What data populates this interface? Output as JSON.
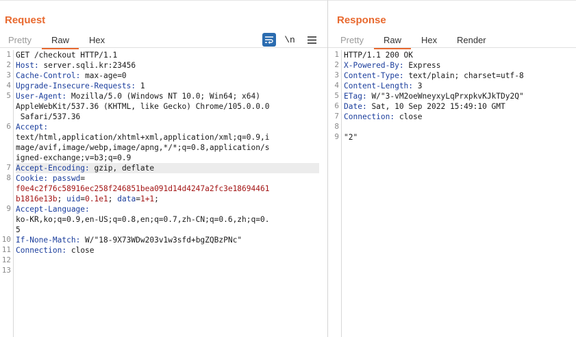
{
  "request": {
    "title": "Request",
    "tabs": [
      "Pretty",
      "Raw",
      "Hex"
    ],
    "active_tab": "Raw",
    "tools": {
      "wrap_icon": "wrap-lines-icon",
      "newline_label": "\\n",
      "menu_icon": "hamburger-menu-icon"
    },
    "line_numbers": [
      "1",
      "2",
      "3",
      "4",
      "5",
      "6",
      "7",
      "8",
      "9",
      "10",
      "11",
      "12",
      "13"
    ],
    "lines": [
      {
        "key": "",
        "val": "GET /checkout HTTP/1.1"
      },
      {
        "key": "Host",
        "val": " server.sqli.kr:23456"
      },
      {
        "key": "Cache-Control",
        "val": " max-age=0"
      },
      {
        "key": "Upgrade-Insecure-Requests",
        "val": " 1"
      },
      {
        "key": "User-Agent",
        "val": " Mozilla/5.0 (Windows NT 10.0; Win64; x64)"
      },
      {
        "key": "",
        "val": "AppleWebKit/537.36 (KHTML, like Gecko) Chrome/105.0.0.0"
      },
      {
        "key": "",
        "val": " Safari/537.36"
      },
      {
        "key": "Accept",
        "val": ""
      },
      {
        "key": "",
        "val": "text/html,application/xhtml+xml,application/xml;q=0.9,i"
      },
      {
        "key": "",
        "val": "mage/avif,image/webp,image/apng,*/*;q=0.8,application/s"
      },
      {
        "key": "",
        "val": "igned-exchange;v=b3;q=0.9"
      },
      {
        "key": "Accept-Encoding",
        "val": " gzip, deflate"
      },
      {
        "key": "Cookie",
        "val": " "
      },
      {
        "key": "",
        "val": "f0e4c2f76c58916ec258f246851bea091d14d4247a2fc3e18694461"
      },
      {
        "key": "",
        "val": "b1816e13b"
      },
      {
        "key": "Accept-Language",
        "val": ""
      },
      {
        "key": "",
        "val": "ko-KR,ko;q=0.9,en-US;q=0.8,en;q=0.7,zh-CN;q=0.6,zh;q=0."
      },
      {
        "key": "",
        "val": "5"
      },
      {
        "key": "If-None-Match",
        "val": " W/\"18-9X73WDw203v1w3sfd+bgZQBzPNc\""
      },
      {
        "key": "Connection",
        "val": " close"
      }
    ],
    "cookie": {
      "passwd_key": "passwd",
      "uid_key": "uid",
      "uid_val": "0.1e1",
      "data_key": "data",
      "data_val": "1+1"
    }
  },
  "response": {
    "title": "Response",
    "tabs": [
      "Pretty",
      "Raw",
      "Hex",
      "Render"
    ],
    "active_tab": "Raw",
    "line_numbers": [
      "1",
      "2",
      "3",
      "4",
      "5",
      "6",
      "7",
      "8",
      "9"
    ],
    "lines": [
      {
        "key": "",
        "val": "HTTP/1.1 200 OK"
      },
      {
        "key": "X-Powered-By",
        "val": " Express"
      },
      {
        "key": "Content-Type",
        "val": " text/plain; charset=utf-8"
      },
      {
        "key": "Content-Length",
        "val": " 3"
      },
      {
        "key": "ETag",
        "val": " W/\"3-vM2oeWneyxyLqPrxpkvKJkTDy2Q\""
      },
      {
        "key": "Date",
        "val": " Sat, 10 Sep 2022 15:49:10 GMT"
      },
      {
        "key": "Connection",
        "val": " close"
      },
      {
        "key": "",
        "val": ""
      },
      {
        "key": "",
        "val": "\"2\""
      }
    ]
  },
  "colors": {
    "accent": "#e8692f",
    "header_key": "#1a3d9c",
    "cookie_value": "#a31515",
    "wrap_button": "#2b6cb0"
  }
}
